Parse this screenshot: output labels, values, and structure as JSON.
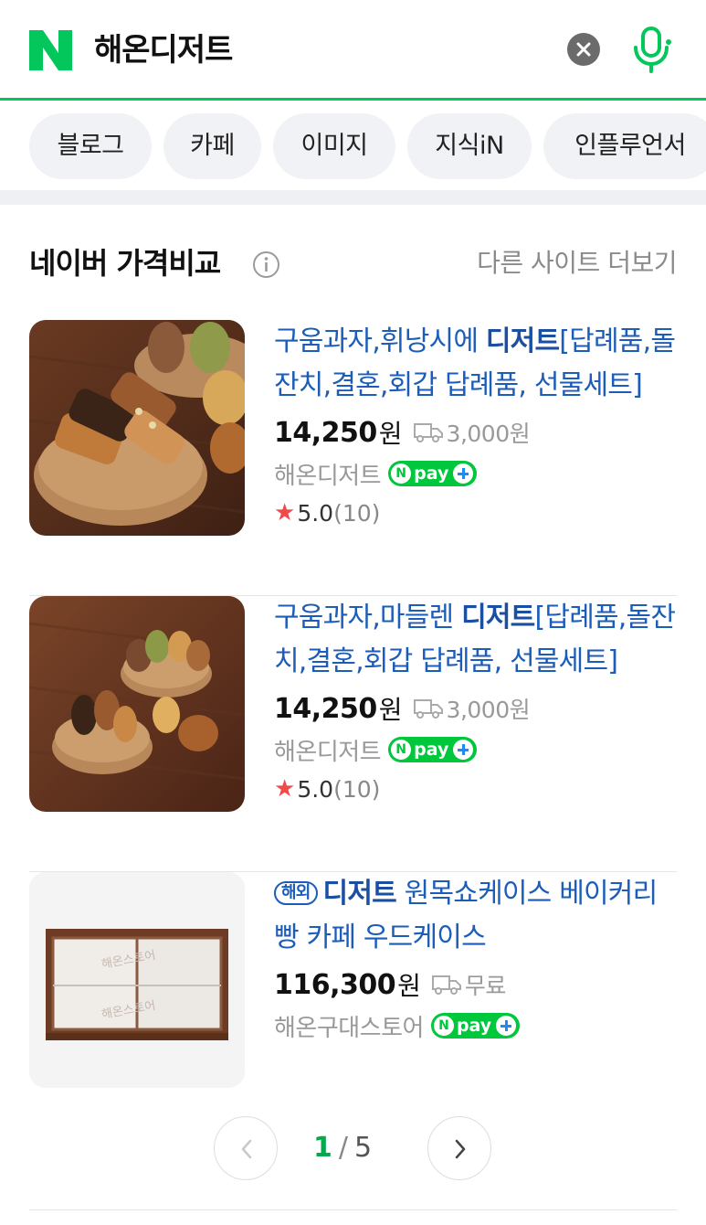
{
  "search": {
    "query": "해온디저트",
    "logo_letter": "N",
    "clear_icon": "close-icon",
    "mic_icon": "microphone-icon",
    "brand_color": "#03c75a"
  },
  "tabs": [
    {
      "label": "블로그"
    },
    {
      "label": "카페"
    },
    {
      "label": "이미지"
    },
    {
      "label": "지식iN"
    },
    {
      "label": "인플루언서"
    }
  ],
  "section": {
    "title": "네이버 가격비교",
    "info_icon": "info-icon",
    "more_label": "다른 사이트 더보기"
  },
  "products": [
    {
      "title_pre": "구움과자,휘낭시에 ",
      "title_bold": "디저트",
      "title_post": "[답례품,돌잔치,결혼,회갑 답례품, 선물세트]",
      "price": "14,250",
      "currency": "원",
      "shipping": "3,000원",
      "seller": "해온디저트",
      "npay": "pay",
      "rating": "5.0",
      "review_count": "(10)",
      "image": "baked-goods-photo"
    },
    {
      "title_pre": "구움과자,마들렌 ",
      "title_bold": "디저트",
      "title_post": "[답례품,돌잔치,결혼,회갑 답례품, 선물세트]",
      "price": "14,250",
      "currency": "원",
      "shipping": "3,000원",
      "seller": "해온디저트",
      "npay": "pay",
      "rating": "5.0",
      "review_count": "(10)",
      "image": "madeleine-photo"
    },
    {
      "badge": "해외",
      "title_bold": "디저트",
      "title_post": " 원목쇼케이스 베이커리 빵 카페 우드케이스",
      "price": "116,300",
      "currency": "원",
      "shipping": "무료",
      "seller": "해온구대스토어",
      "npay": "pay",
      "image": "wooden-showcase-photo",
      "watermark": "해온스토어"
    }
  ],
  "pagination": {
    "current": "1",
    "separator": "/",
    "total": "5",
    "prev_icon": "chevron-left-icon",
    "next_icon": "chevron-right-icon"
  }
}
